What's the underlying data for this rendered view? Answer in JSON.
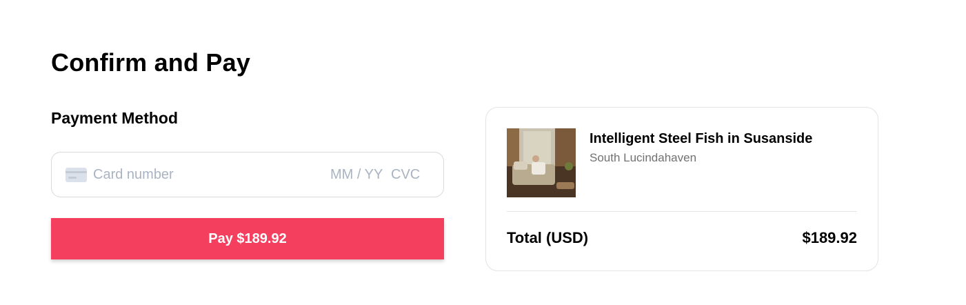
{
  "page": {
    "title": "Confirm and Pay"
  },
  "payment": {
    "section_title": "Payment Method",
    "card_number_placeholder": "Card number",
    "expiry_placeholder": "MM / YY",
    "cvc_placeholder": "CVC",
    "card_icon": "credit-card-icon",
    "pay_button_label": "Pay $189.92"
  },
  "summary": {
    "listing_title": "Intelligent Steel Fish in Susanside",
    "listing_location": "South Lucindahaven",
    "total_label": "Total (USD)",
    "total_value": "$189.92"
  },
  "colors": {
    "accent": "#f43f5e",
    "muted_text": "#717171",
    "placeholder": "#aab3c2",
    "border": "#d9d9d9"
  }
}
